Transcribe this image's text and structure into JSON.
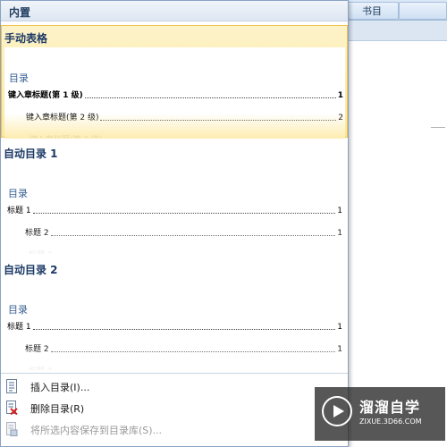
{
  "background": {
    "tab_label": "书目"
  },
  "panel": {
    "header": "内置",
    "items": [
      {
        "title": "手动表格",
        "toc_heading": "目录",
        "rows": [
          {
            "text": "键入章标题(第 1 级)",
            "page": "1"
          },
          {
            "text": "键入章标题(第 2 级)",
            "page": "2"
          }
        ],
        "partial": "键入章标题(第 3 级)"
      },
      {
        "title": "自动目录 1",
        "toc_heading": "目录",
        "rows": [
          {
            "text": "标题 1",
            "page": "1"
          },
          {
            "text": "标题 2",
            "page": "1"
          }
        ],
        "partial": "标题 3"
      },
      {
        "title": "自动目录 2",
        "toc_heading": "目录",
        "rows": [
          {
            "text": "标题 1",
            "page": "1"
          },
          {
            "text": "标题 2",
            "page": "1"
          }
        ],
        "partial": "标题 3"
      }
    ]
  },
  "menu": {
    "insert_toc": "插入目录(I)...",
    "delete_toc": "删除目录(R)",
    "save_selection": "将所选内容保存到目录库(S)..."
  },
  "watermark": {
    "title": "溜溜自学",
    "url": "ZIXUE.3D66.COM"
  }
}
